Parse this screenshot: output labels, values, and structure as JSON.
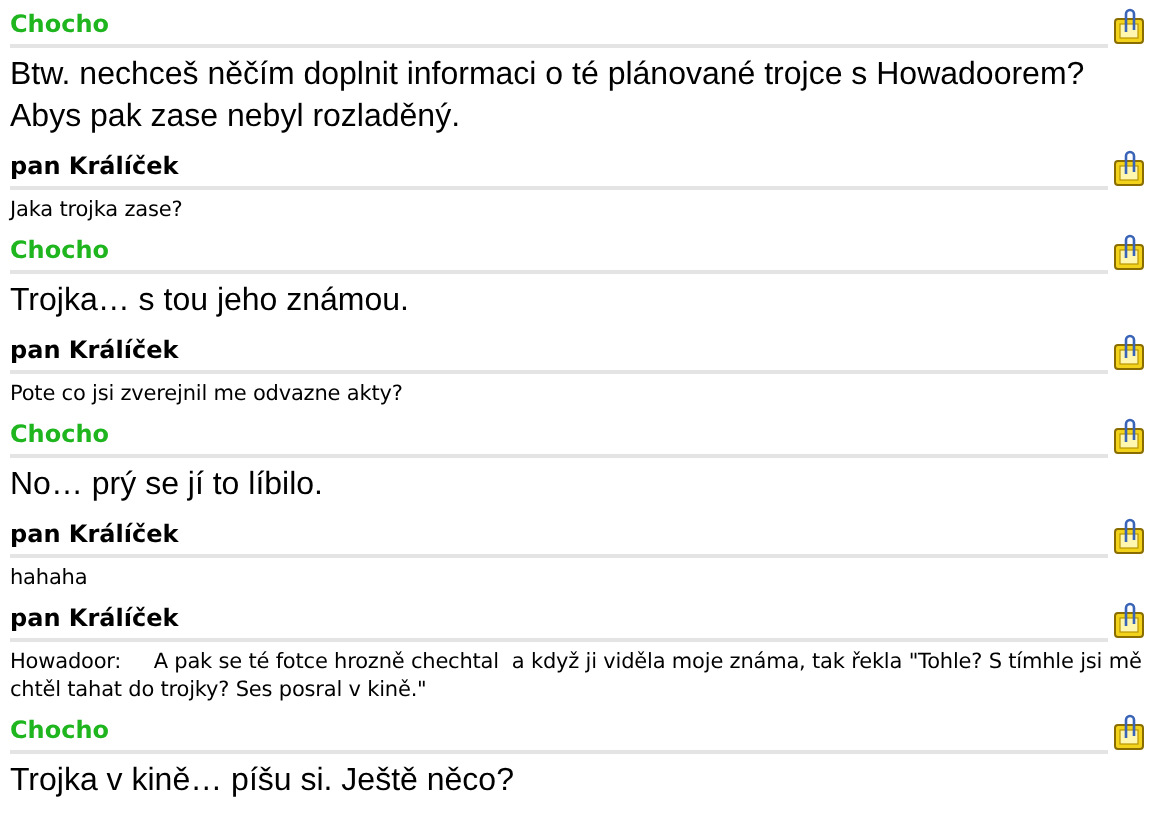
{
  "messages": [
    {
      "sender": "Chocho",
      "color": "#1fb51f",
      "kind": "large",
      "text": "Btw. nechceš něčím doplnit informaci o té plánované trojce s Howadoorem? Abys pak zase nebyl rozladěný."
    },
    {
      "sender": "pan Králíček",
      "color": "#000000",
      "kind": "small",
      "text": "Jaka trojka zase?"
    },
    {
      "sender": "Chocho",
      "color": "#1fb51f",
      "kind": "large",
      "text": "Trojka… s tou jeho známou."
    },
    {
      "sender": "pan Králíček",
      "color": "#000000",
      "kind": "small",
      "text": "Pote co jsi zverejnil me odvazne akty?"
    },
    {
      "sender": "Chocho",
      "color": "#1fb51f",
      "kind": "large",
      "text": "No… prý se jí to líbilo."
    },
    {
      "sender": "pan Králíček",
      "color": "#000000",
      "kind": "small",
      "text": "hahaha"
    },
    {
      "sender": "pan Králíček",
      "color": "#000000",
      "kind": "small",
      "text": "Howadoor:     A pak se té fotce hrozně chechtal  a když ji viděla moje známa, tak řekla \"Tohle? S tímhle jsi mě chtěl tahat do trojky? Ses posral v kině.\""
    },
    {
      "sender": "Chocho",
      "color": "#1fb51f",
      "kind": "large",
      "text": "Trojka v kině… píšu si. Ještě něco?"
    }
  ]
}
